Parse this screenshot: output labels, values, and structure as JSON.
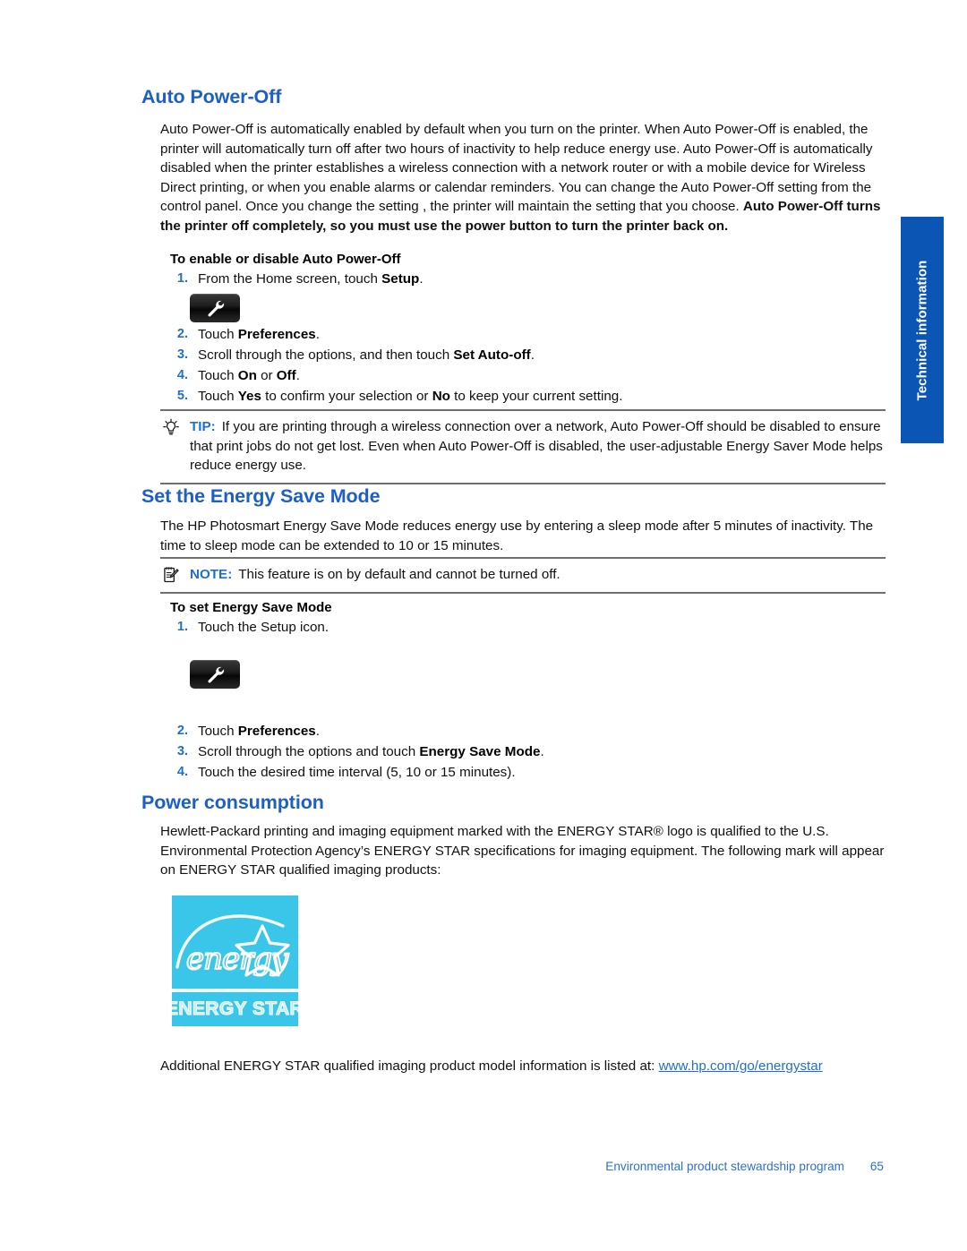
{
  "side_tab": {
    "label": "Technical information",
    "color": "#0b55b5"
  },
  "sections": {
    "auto_power_off": {
      "heading": "Auto Power-Off",
      "intro_plain_1": "Auto Power-Off is automatically enabled by default when you turn on the printer. When Auto Power-Off is enabled, the printer will automatically turn off after two hours of inactivity to help reduce energy use. Auto Power-Off is automatically disabled when the printer establishes a wireless connection with a network router or with a mobile device for Wireless Direct printing, or when you enable alarms or calendar reminders. You can change the Auto Power-Off setting from the control panel. Once you change the setting , the printer will maintain the setting that you choose. ",
      "intro_bold": "Auto Power-Off turns the printer off completely, so you must use the power button to turn the printer back on.",
      "procedure_title": "To enable or disable Auto Power-Off",
      "steps": [
        {
          "num": "1.",
          "pre": "From the Home screen, touch ",
          "bold": "Setup",
          "post": "."
        },
        {
          "num": "2.",
          "pre": "Touch ",
          "bold": "Preferences",
          "post": "."
        },
        {
          "num": "3.",
          "pre": "Scroll through the options, and then touch ",
          "bold": "Set Auto-off",
          "post": "."
        },
        {
          "num": "4.",
          "pre": "Touch ",
          "bold": "On",
          "mid": " or ",
          "bold2": "Off",
          "post": "."
        },
        {
          "num": "5.",
          "pre": "Touch ",
          "bold": "Yes",
          "mid": " to confirm your selection or ",
          "bold2": "No",
          "post": " to keep your current setting."
        }
      ],
      "tip": {
        "keyword": "TIP:",
        "icon": "lightbulb-icon",
        "text": "If you are printing through a wireless connection over a network, Auto Power-Off should be disabled to ensure that print jobs do not get lost. Even when Auto Power-Off is disabled, the user-adjustable Energy Saver Mode helps reduce energy use."
      }
    },
    "energy_save_mode": {
      "heading": "Set the Energy Save Mode",
      "intro": "The HP Photosmart Energy Save Mode reduces energy use by entering a sleep mode after 5 minutes of inactivity. The time to sleep mode can be extended to 10 or 15 minutes.",
      "note": {
        "keyword": "NOTE:",
        "icon": "note-pencil-icon",
        "text": "This feature is on by default and cannot be turned off."
      },
      "procedure_title": "To set Energy Save Mode",
      "step1": {
        "num": "1.",
        "text": "Touch the Setup icon."
      },
      "steps": [
        {
          "num": "2.",
          "pre": "Touch ",
          "bold": "Preferences",
          "post": "."
        },
        {
          "num": "3.",
          "pre": "Scroll through the options and touch ",
          "bold": "Energy Save Mode",
          "post": "."
        },
        {
          "num": "4.",
          "pre": "Touch the desired time interval (5, 10 or 15 minutes).",
          "bold": "",
          "post": ""
        }
      ]
    },
    "power_consumption": {
      "heading": "Power consumption",
      "intro": "Hewlett-Packard printing and imaging equipment marked with the ENERGY STAR® logo is qualified to the U.S. Environmental Protection Agency’s ENERGY STAR specifications for imaging equipment. The following mark will appear on ENERGY STAR qualified imaging products:",
      "logo": {
        "name": "energy-star-logo",
        "script_text": "energy",
        "band_text": "ENERGY STAR",
        "background_color": "#3ac6e8",
        "mark_color": "#ffffff"
      },
      "closing_pre": "Additional ENERGY STAR qualified imaging product model information is listed at: ",
      "closing_link": "www.hp.com/go/energystar"
    }
  },
  "footer": {
    "text": "Environmental product stewardship program",
    "page_number": "65"
  }
}
